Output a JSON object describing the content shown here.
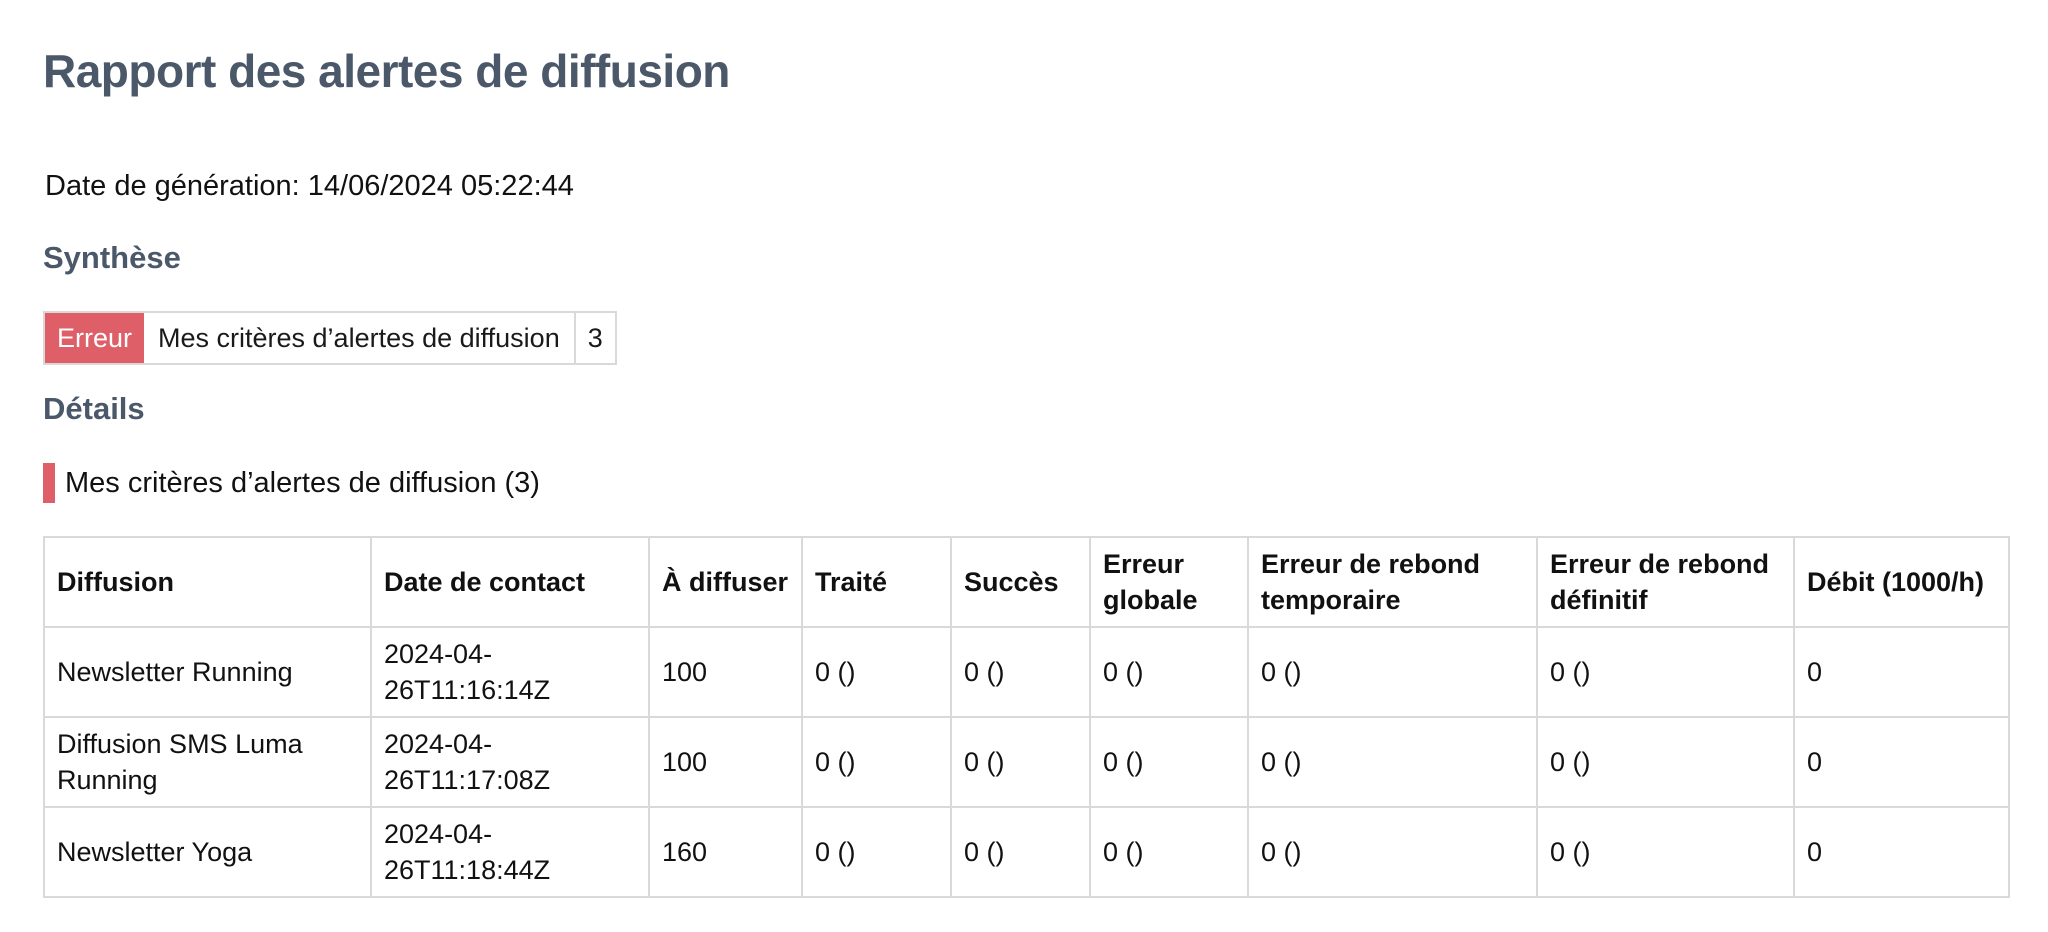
{
  "report": {
    "title": "Rapport des alertes de diffusion",
    "generation_date": "Date de génération: 14/06/2024 05:22:44"
  },
  "summary": {
    "heading": "Synthèse",
    "status": "Erreur",
    "criteria": "Mes critères d’alertes de diffusion",
    "count": "3"
  },
  "details": {
    "heading": "Détails",
    "criteria_label": "Mes critères d’alertes de diffusion (3)"
  },
  "colors": {
    "error_accent": "#de5f67",
    "heading": "#4b5869",
    "border": "#d9d9d9"
  },
  "table": {
    "headers": [
      "Diffusion",
      "Date de contact",
      "À diffuser",
      "Traité",
      "Succès",
      "Erreur globale",
      "Erreur de rebond temporaire",
      "Erreur de rebond définitif",
      "Débit (1000/h)"
    ],
    "rows": [
      [
        "Newsletter Running",
        "2024-04-26T11:16:14Z",
        "100",
        "0 ()",
        "0 ()",
        "0 ()",
        "0 ()",
        "0 ()",
        "0"
      ],
      [
        "Diffusion SMS Luma Running",
        "2024-04-26T11:17:08Z",
        "100",
        "0 ()",
        "0 ()",
        "0 ()",
        "0 ()",
        "0 ()",
        "0"
      ],
      [
        "Newsletter Yoga",
        "2024-04-26T11:18:44Z",
        "160",
        "0 ()",
        "0 ()",
        "0 ()",
        "0 ()",
        "0 ()",
        "0"
      ]
    ]
  }
}
